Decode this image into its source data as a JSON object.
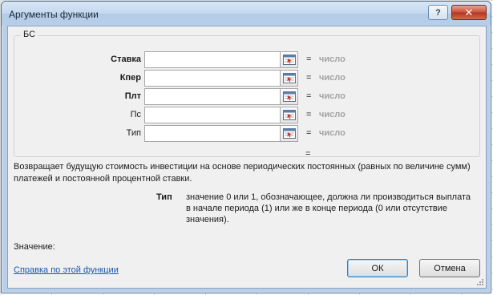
{
  "window": {
    "title": "Аргументы функции",
    "help_button": "?",
    "close_button": "✕"
  },
  "group": {
    "legend": "БС"
  },
  "args": [
    {
      "label": "Ставка",
      "value": "",
      "equals": "=",
      "result": "число"
    },
    {
      "label": "Кпер",
      "value": "",
      "equals": "=",
      "result": "число"
    },
    {
      "label": "Плт",
      "value": "",
      "equals": "=",
      "result": "число"
    },
    {
      "label": "Пс",
      "value": "",
      "equals": "=",
      "result": "число"
    },
    {
      "label": "Тип",
      "value": "",
      "equals": "=",
      "result": "число"
    }
  ],
  "result_equals": "=",
  "description": "Возвращает будущую стоимость инвестиции на основе периодических постоянных (равных по величине сумм) платежей и постоянной процентной ставки.",
  "arg_help": {
    "name": "Тип",
    "text": "значение 0 или 1, обозначающее, должна ли производиться выплата в начале периода (1) или же в конце периода (0 или отсутствие значения)."
  },
  "value_label": "Значение:",
  "help_link": "Справка по этой функции",
  "buttons": {
    "ok": "ОК",
    "cancel": "Отмена"
  },
  "icons": {
    "ref_button": "collapse-dialog-icon"
  },
  "colors": {
    "frame": "#b9cfe8",
    "close": "#c8503a",
    "link": "#1a56b3",
    "placeholder_value": "#a3a3a3"
  }
}
